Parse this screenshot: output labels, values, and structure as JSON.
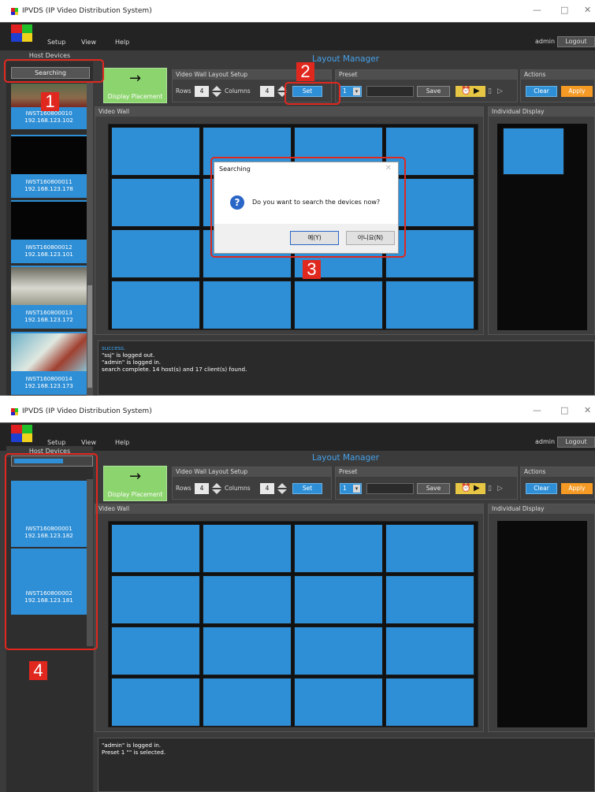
{
  "window": {
    "title": "IPVDS (IP Video Distribution System)",
    "minimize": "—",
    "maximize": "□",
    "close": "✕"
  },
  "menu": {
    "setup": "Setup",
    "view": "View",
    "help": "Help",
    "user": "admin",
    "logout": "Logout"
  },
  "colors": {
    "accent_blue": "#2f8fd6",
    "apply_orange": "#f49a25",
    "display_green": "#8cd46d",
    "annotation_red": "#e0281f"
  },
  "sidebar": {
    "header": "Host Devices",
    "search_button": "Searching"
  },
  "devices_before": [
    {
      "name": "IWST160800010",
      "ip": "192.168.123.102"
    },
    {
      "name": "IWST160800011",
      "ip": "192.168.123.178"
    },
    {
      "name": "IWST160800012",
      "ip": "192.168.123.101"
    },
    {
      "name": "IWST160800013",
      "ip": "192.168.123.172"
    },
    {
      "name": "IWST160800014",
      "ip": "192.168.123.173"
    }
  ],
  "devices_after": [
    {
      "name": "IWST160800001",
      "ip": "192.168.123.182"
    },
    {
      "name": "IWST160800002",
      "ip": "192.168.123.181"
    }
  ],
  "layout_manager": {
    "title": "Layout Manager",
    "display_placement": "Display Placement",
    "arrow": "→",
    "setup_panel": {
      "title": "Video Wall Layout Setup",
      "rows_label": "Rows",
      "rows": "4",
      "columns_label": "Columns",
      "columns": "4",
      "set": "Set"
    },
    "preset_panel": {
      "title": "Preset",
      "value": "1",
      "save": "Save"
    },
    "actions_panel": {
      "title": "Actions",
      "clear": "Clear",
      "apply": "Apply"
    },
    "video_wall": {
      "title": "Video Wall",
      "rows": 4,
      "columns": 4
    },
    "individual_display": {
      "title": "Individual Display"
    }
  },
  "log_before": [
    "success.",
    "\"ssj\" is logged out.",
    "\"admin\" is logged in.",
    "search complete. 14 host(s) and 17 client(s) found."
  ],
  "log_after": [
    "\"admin\" is logged in.",
    "Preset 1 \"\" is selected."
  ],
  "dialog": {
    "title": "Searching",
    "close": "✕",
    "message": "Do you want to search the devices now?",
    "yes": "예(Y)",
    "no": "아니요(N)"
  },
  "annotations": [
    "1",
    "2",
    "3",
    "4"
  ]
}
